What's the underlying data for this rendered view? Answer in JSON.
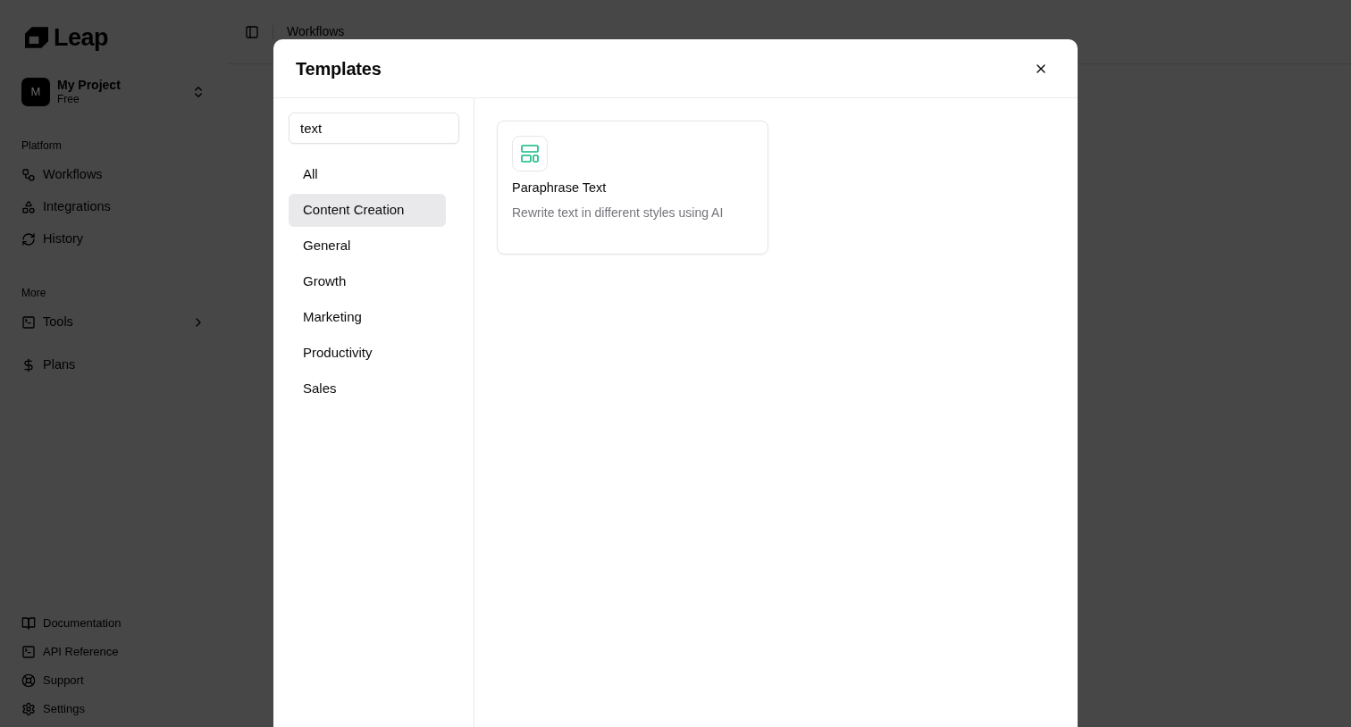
{
  "sidebar": {
    "logo": "Leap",
    "project": {
      "avatar": "M",
      "name": "My Project",
      "plan": "Free"
    },
    "groups": [
      {
        "heading": "Platform",
        "items": [
          {
            "label": "Workflows",
            "submenu": false
          },
          {
            "label": "Integrations",
            "submenu": false
          },
          {
            "label": "History",
            "submenu": false
          }
        ]
      },
      {
        "heading": "More",
        "items": [
          {
            "label": "Tools",
            "submenu": true
          }
        ]
      },
      {
        "items": [
          {
            "label": "Plans",
            "submenu": false
          }
        ]
      }
    ],
    "footer_links": [
      "Documentation",
      "API Reference",
      "Support",
      "Settings"
    ]
  },
  "header": {
    "breadcrumb": "Workflows"
  },
  "dialog": {
    "title": "Templates",
    "search": {
      "value": "text"
    },
    "categories": [
      {
        "label": "All",
        "selected": false
      },
      {
        "label": "Content Creation",
        "selected": true
      },
      {
        "label": "General",
        "selected": false
      },
      {
        "label": "Growth",
        "selected": false
      },
      {
        "label": "Marketing",
        "selected": false
      },
      {
        "label": "Productivity",
        "selected": false
      },
      {
        "label": "Sales",
        "selected": false
      }
    ],
    "templates": [
      {
        "title": "Paraphrase Text",
        "description": "Rewrite text in different styles using AI"
      }
    ]
  }
}
